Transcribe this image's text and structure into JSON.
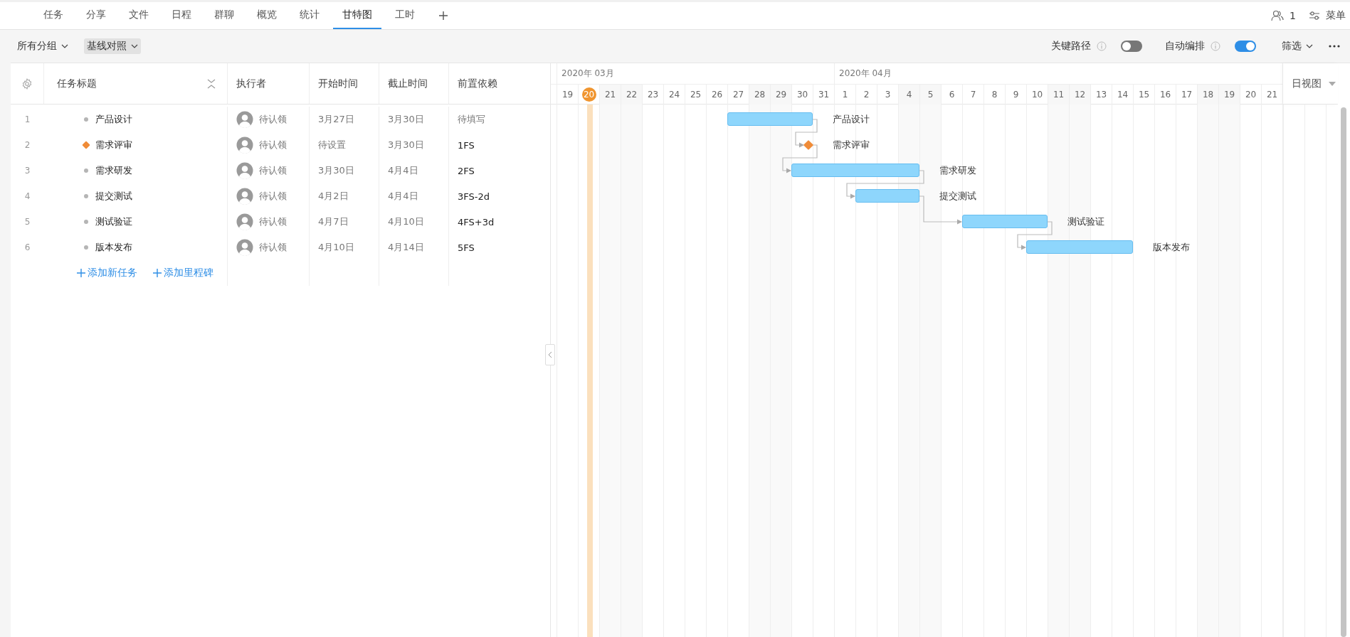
{
  "tabs": [
    {
      "label": "任务",
      "selected": false
    },
    {
      "label": "分享",
      "selected": false
    },
    {
      "label": "文件",
      "selected": false
    },
    {
      "label": "日程",
      "selected": false
    },
    {
      "label": "群聊",
      "selected": false
    },
    {
      "label": "概览",
      "selected": false
    },
    {
      "label": "统计",
      "selected": false
    },
    {
      "label": "甘特图",
      "selected": true
    },
    {
      "label": "工时",
      "selected": false
    }
  ],
  "top_right": {
    "member_count": "1",
    "menu_label": "菜单"
  },
  "toolbar": {
    "dropdowns": [
      {
        "label": "所有分组",
        "highlighted": false
      },
      {
        "label": "基线对照",
        "highlighted": true
      }
    ],
    "toggles": [
      {
        "label": "关键路径",
        "on": false
      },
      {
        "label": "自动编排",
        "on": true
      }
    ],
    "filter_label": "筛选"
  },
  "table": {
    "columns": [
      "任务标题",
      "执行者",
      "开始时间",
      "截止时间",
      "前置依赖"
    ],
    "rows": [
      {
        "number": "1",
        "kind": "task",
        "title": "产品设计",
        "assignee": "待认领",
        "start": "3月27日",
        "end": "3月30日",
        "dependency": "待填写",
        "dependency_empty": true
      },
      {
        "number": "2",
        "kind": "milestone",
        "title": "需求评审",
        "assignee": "待认领",
        "start": "待设置",
        "end": "3月30日",
        "dependency": "1FS",
        "dependency_empty": false
      },
      {
        "number": "3",
        "kind": "task",
        "title": "需求研发",
        "assignee": "待认领",
        "start": "3月30日",
        "end": "4月4日",
        "dependency": "2FS",
        "dependency_empty": false
      },
      {
        "number": "4",
        "kind": "task",
        "title": "提交测试",
        "assignee": "待认领",
        "start": "4月2日",
        "end": "4月4日",
        "dependency": "3FS-2d",
        "dependency_empty": false
      },
      {
        "number": "5",
        "kind": "task",
        "title": "测试验证",
        "assignee": "待认领",
        "start": "4月7日",
        "end": "4月10日",
        "dependency": "4FS+3d",
        "dependency_empty": false
      },
      {
        "number": "6",
        "kind": "task",
        "title": "版本发布",
        "assignee": "待认领",
        "start": "4月10日",
        "end": "4月14日",
        "dependency": "5FS",
        "dependency_empty": false
      }
    ],
    "add_actions": [
      "添加新任务",
      "添加里程碑"
    ]
  },
  "gantt": {
    "months": [
      {
        "label": "2020年 03月",
        "days": [
          {
            "label": "19",
            "weekend": false,
            "selected": false
          },
          {
            "label": "20",
            "weekend": false,
            "selected": true
          },
          {
            "label": "21",
            "weekend": true,
            "selected": false
          },
          {
            "label": "22",
            "weekend": true,
            "selected": false
          },
          {
            "label": "23",
            "weekend": false,
            "selected": false
          },
          {
            "label": "24",
            "weekend": false,
            "selected": false
          },
          {
            "label": "25",
            "weekend": false,
            "selected": false
          },
          {
            "label": "26",
            "weekend": false,
            "selected": false
          },
          {
            "label": "27",
            "weekend": false,
            "selected": false
          },
          {
            "label": "28",
            "weekend": true,
            "selected": false
          },
          {
            "label": "29",
            "weekend": true,
            "selected": false
          },
          {
            "label": "30",
            "weekend": false,
            "selected": false
          },
          {
            "label": "31",
            "weekend": false,
            "selected": false
          }
        ]
      },
      {
        "label": "2020年 04月",
        "days": [
          {
            "label": "1",
            "weekend": false,
            "selected": false
          },
          {
            "label": "2",
            "weekend": false,
            "selected": false
          },
          {
            "label": "3",
            "weekend": false,
            "selected": false
          },
          {
            "label": "4",
            "weekend": true,
            "selected": false
          },
          {
            "label": "5",
            "weekend": true,
            "selected": false
          },
          {
            "label": "6",
            "weekend": false,
            "selected": false
          },
          {
            "label": "7",
            "weekend": false,
            "selected": false
          },
          {
            "label": "8",
            "weekend": false,
            "selected": false
          },
          {
            "label": "9",
            "weekend": false,
            "selected": false
          },
          {
            "label": "10",
            "weekend": false,
            "selected": false
          },
          {
            "label": "11",
            "weekend": true,
            "selected": false
          },
          {
            "label": "12",
            "weekend": true,
            "selected": false
          },
          {
            "label": "13",
            "weekend": false,
            "selected": false
          },
          {
            "label": "14",
            "weekend": false,
            "selected": false
          },
          {
            "label": "15",
            "weekend": false,
            "selected": false
          },
          {
            "label": "16",
            "weekend": false,
            "selected": false
          },
          {
            "label": "17",
            "weekend": false,
            "selected": false
          },
          {
            "label": "18",
            "weekend": true,
            "selected": false
          },
          {
            "label": "19",
            "weekend": true,
            "selected": false
          },
          {
            "label": "20",
            "weekend": false,
            "selected": false
          },
          {
            "label": "21",
            "weekend": false,
            "selected": false
          }
        ]
      }
    ],
    "view_label": "日视图",
    "bars": [
      {
        "label": "产品设计"
      },
      {
        "label": "需求评审"
      },
      {
        "label": "需求研发"
      },
      {
        "label": "提交测试"
      },
      {
        "label": "测试验证"
      },
      {
        "label": "版本发布"
      }
    ]
  }
}
